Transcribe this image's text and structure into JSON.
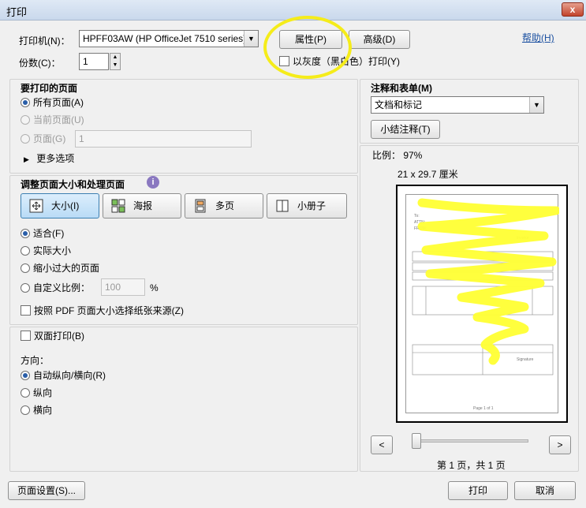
{
  "window": {
    "title": "打印",
    "close": "x"
  },
  "printer": {
    "label": "打印机(N)：",
    "selected": "HPFF03AW (HP OfficeJet 7510 series)",
    "properties_btn": "属性(P)",
    "advanced_btn": "高级(D)",
    "help_link": "帮助(H)",
    "copies_label": "份数(C)：",
    "copies_value": "1",
    "grayscale_label": "以灰度（黑白色）打印(Y)"
  },
  "pages_to_print": {
    "title": "要打印的页面",
    "options": [
      "所有页面(A)",
      "当前页面(U)",
      "页面(G)"
    ],
    "page_range_value": "1",
    "more_options": "更多选项"
  },
  "sizing": {
    "title": "调整页面大小和处理页面",
    "modes": [
      "大小(I)",
      "海报",
      "多页",
      "小册子"
    ],
    "fit_options": [
      "适合(F)",
      "实际大小",
      "缩小过大的页面",
      "自定义比例："
    ],
    "custom_scale_value": "100",
    "percent": "%",
    "pdf_paper_source": "按照 PDF 页面大小选择纸张来源(Z)"
  },
  "duplex": {
    "label": "双面打印(B)"
  },
  "orientation": {
    "title": "方向：",
    "options": [
      "自动纵向/横向(R)",
      "纵向",
      "横向"
    ]
  },
  "comments": {
    "title": "注释和表单(M)",
    "selected": "文档和标记",
    "summarize_btn": "小结注释(T)"
  },
  "preview": {
    "scale": "比例：  97%",
    "paper_size": "21 x 29.7 厘米",
    "prev": "<",
    "next": ">",
    "page_counter": "第 1 页，共 1 页",
    "doc_label_1": "Invoice",
    "doc_label_2": "Signature",
    "doc_footer": "Page 1 of 1"
  },
  "footer": {
    "page_setup_btn": "页面设置(S)...",
    "print_btn": "打印",
    "cancel_btn": "取消"
  },
  "colors": {
    "highlight_circle": "#f5ec1a",
    "scribble": "#ffff33",
    "link": "#1a4fa0"
  },
  "icons": {
    "info": "info-icon",
    "more_options": "triangle-right-icon",
    "size_mode": "size-arrows-icon",
    "poster_mode": "poster-icon",
    "multi_mode": "multi-page-icon",
    "booklet_mode": "booklet-icon"
  }
}
